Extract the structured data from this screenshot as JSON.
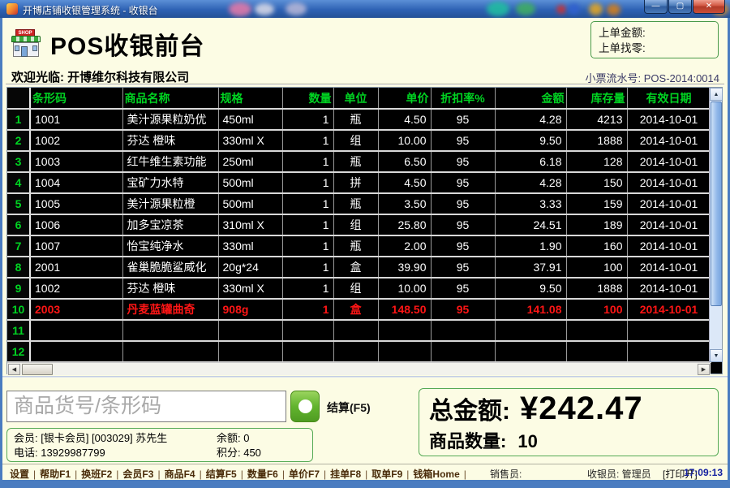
{
  "window": {
    "title": "开博店铺收银管理系统 - 收银台",
    "controls": {
      "minimize": "—",
      "maximize": "▢",
      "close": "✕"
    }
  },
  "header": {
    "title": "POS收银前台",
    "shop_sign": "SHOP",
    "prev_amount_label": "上单金额:",
    "prev_change_label": "上单找零:",
    "welcome": "欢迎光临: 开博维尔科技有限公司",
    "receipt_no": "小票流水号: POS-2014:0014"
  },
  "table": {
    "headers": [
      "条形码",
      "商品名称",
      "规格",
      "数量",
      "单位",
      "单价",
      "折扣率%",
      "金额",
      "库存量",
      "有效日期"
    ],
    "highlight_row": 10,
    "rows": [
      [
        "1001",
        "美汁源果粒奶优",
        "450ml",
        "1",
        "瓶",
        "4.50",
        "95",
        "4.28",
        "4213",
        "2014-10-01"
      ],
      [
        "1002",
        "芬达 橙味",
        "330ml X",
        "1",
        "组",
        "10.00",
        "95",
        "9.50",
        "1888",
        "2014-10-01"
      ],
      [
        "1003",
        "红牛维生素功能",
        "250ml",
        "1",
        "瓶",
        "6.50",
        "95",
        "6.18",
        "128",
        "2014-10-01"
      ],
      [
        "1004",
        "宝矿力水特",
        "500ml",
        "1",
        "拼",
        "4.50",
        "95",
        "4.28",
        "150",
        "2014-10-01"
      ],
      [
        "1005",
        "美汁源果粒橙",
        "500ml",
        "1",
        "瓶",
        "3.50",
        "95",
        "3.33",
        "159",
        "2014-10-01"
      ],
      [
        "1006",
        "加多宝凉茶",
        "310ml X",
        "1",
        "组",
        "25.80",
        "95",
        "24.51",
        "189",
        "2014-10-01"
      ],
      [
        "1007",
        "怡宝纯净水",
        "330ml",
        "1",
        "瓶",
        "2.00",
        "95",
        "1.90",
        "160",
        "2014-10-01"
      ],
      [
        "2001",
        "雀巢脆脆鲨威化",
        "20g*24",
        "1",
        "盒",
        "39.90",
        "95",
        "37.91",
        "100",
        "2014-10-01"
      ],
      [
        "1002",
        "芬达 橙味",
        "330ml X",
        "1",
        "组",
        "10.00",
        "95",
        "9.50",
        "1888",
        "2014-10-01"
      ],
      [
        "2003",
        "丹麦蓝罐曲奇",
        "908g",
        "1",
        "盒",
        "148.50",
        "95",
        "141.08",
        "100",
        "2014-10-01"
      ],
      [
        "",
        "",
        "",
        "",
        "",
        "",
        "",
        "",
        "",
        ""
      ],
      [
        "",
        "",
        "",
        "",
        "",
        "",
        "",
        "",
        "",
        ""
      ]
    ]
  },
  "checkout": {
    "placeholder": "商品货号/条形码",
    "settle_label": "结算(F5)",
    "member_line": "会员: [银卡会员] [003029] 苏先生",
    "balance": "余额: 0",
    "phone": "电话: 13929987799",
    "points": "积分: 450",
    "total_label": "总金额:",
    "total_value": "¥242.47",
    "qty_label": "商品数量:",
    "qty_value": "10"
  },
  "statusbar": {
    "menu": [
      "设置",
      "帮助F1",
      "换班F2",
      "会员F3",
      "商品F4",
      "结算F5",
      "数量F6",
      "单价F7",
      "挂单F8",
      "取单F9",
      "钱箱Home"
    ],
    "sales_label": "销售员:",
    "cashier": "收银员: 管理员",
    "print_status": "[打印开]",
    "time": "17:09:13"
  },
  "colors": {
    "table_green": "#00d422",
    "highlight_red": "#ff1515",
    "panel_bg": "#fcfce4",
    "titlebar_blue": "#2e62b4",
    "button_green": "#62b42e",
    "box_border_green": "#55aa55"
  }
}
